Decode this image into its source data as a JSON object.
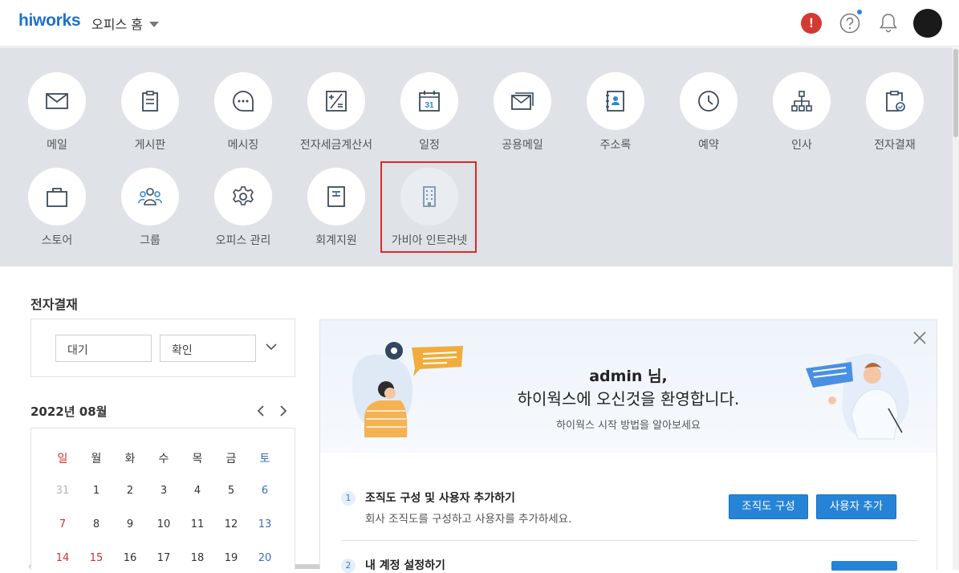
{
  "topbar": {
    "logo": "hiworks",
    "office_home": "오피스 홈",
    "alert_mark": "!"
  },
  "apps": [
    {
      "label": "메일",
      "icon": "mail-icon"
    },
    {
      "label": "게시판",
      "icon": "clipboard-icon"
    },
    {
      "label": "메시징",
      "icon": "chat-bubble-icon"
    },
    {
      "label": "전자세금계산서",
      "icon": "tax-invoice-icon"
    },
    {
      "label": "일정",
      "icon": "calendar-icon",
      "number": "31"
    },
    {
      "label": "공용메일",
      "icon": "shared-mail-icon"
    },
    {
      "label": "주소록",
      "icon": "address-book-icon"
    },
    {
      "label": "예약",
      "icon": "clock-icon"
    },
    {
      "label": "인사",
      "icon": "org-chart-icon"
    },
    {
      "label": "전자결재",
      "icon": "approval-icon"
    },
    {
      "label": "스토어",
      "icon": "shopping-bag-icon"
    },
    {
      "label": "그룹",
      "icon": "group-icon"
    },
    {
      "label": "오피스 관리",
      "icon": "gear-icon"
    },
    {
      "label": "회계지원",
      "icon": "ledger-icon"
    },
    {
      "label": "가비아 인트라넷",
      "icon": "building-icon"
    }
  ],
  "approval": {
    "title": "전자결재",
    "chips": [
      "대기",
      "확인"
    ]
  },
  "calendar": {
    "title": "2022년 08월",
    "weekdays": [
      "일",
      "월",
      "화",
      "수",
      "목",
      "금",
      "토"
    ],
    "weeks": [
      [
        "31",
        "1",
        "2",
        "3",
        "4",
        "5",
        "6"
      ],
      [
        "7",
        "8",
        "9",
        "10",
        "11",
        "12",
        "13"
      ],
      [
        "14",
        "15",
        "16",
        "17",
        "18",
        "19",
        "20"
      ]
    ],
    "colors": {
      "sunday": "#d0312d",
      "saturday": "#3d6cc2",
      "muted": "#b5b5b5",
      "holiday": "#d0312d"
    }
  },
  "welcome": {
    "line1": "admin 님,",
    "line2": "하이웍스에 오신것을 환영합니다.",
    "line3": "하이웍스 시작 방법을 알아보세요",
    "step1": {
      "num": "1",
      "title": "조직도 구성 및 사용자 추가하기",
      "desc": "회사 조직도를 구성하고 사용자를 추가하세요.",
      "btn_org": "조직도 구성",
      "btn_user": "사용자 추가"
    },
    "step2": {
      "num": "2",
      "title": "내 계정 설정하기"
    }
  },
  "accent": "#2684d8"
}
